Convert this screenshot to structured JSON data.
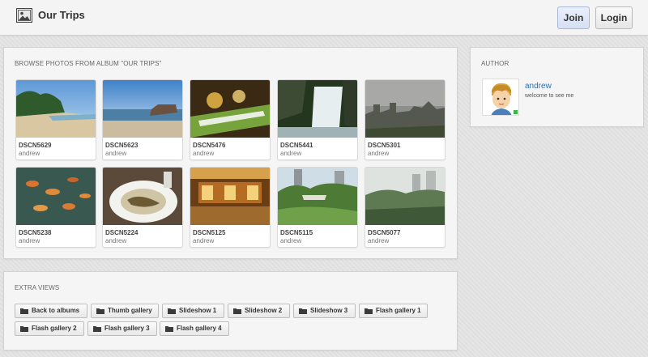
{
  "header": {
    "title": "Our Trips",
    "join_label": "Join",
    "login_label": "Login"
  },
  "album": {
    "heading": "BROWSE PHOTOS FROM ALBUM \"OUR TRIPS\"",
    "photos": [
      {
        "title": "DSCN5629",
        "owner": "andrew"
      },
      {
        "title": "DSCN5623",
        "owner": "andrew"
      },
      {
        "title": "DSCN5476",
        "owner": "andrew"
      },
      {
        "title": "DSCN5441",
        "owner": "andrew"
      },
      {
        "title": "DSCN5301",
        "owner": "andrew"
      },
      {
        "title": "DSCN5238",
        "owner": "andrew"
      },
      {
        "title": "DSCN5224",
        "owner": "andrew"
      },
      {
        "title": "DSCN5125",
        "owner": "andrew"
      },
      {
        "title": "DSCN5115",
        "owner": "andrew"
      },
      {
        "title": "DSCN5077",
        "owner": "andrew"
      }
    ]
  },
  "author": {
    "heading": "AUTHOR",
    "name": "andrew",
    "status": "welcome to see me"
  },
  "extra": {
    "heading": "EXTRA VIEWS",
    "buttons": [
      {
        "label": "Back to albums",
        "icon": "folder-icon"
      },
      {
        "label": "Thumb gallery",
        "icon": "folder-icon"
      },
      {
        "label": "Slideshow 1",
        "icon": "folder-icon"
      },
      {
        "label": "Slideshow 2",
        "icon": "folder-icon"
      },
      {
        "label": "Slideshow 3",
        "icon": "folder-icon"
      },
      {
        "label": "Flash gallery 1",
        "icon": "folder-icon"
      },
      {
        "label": "Flash gallery 2",
        "icon": "folder-icon"
      },
      {
        "label": "Flash gallery 3",
        "icon": "folder-icon"
      },
      {
        "label": "Flash gallery 4",
        "icon": "folder-icon"
      }
    ]
  },
  "colors": {
    "link": "#2a6fb0",
    "join_bg": "#dfe7f7",
    "online": "#39b54a"
  }
}
